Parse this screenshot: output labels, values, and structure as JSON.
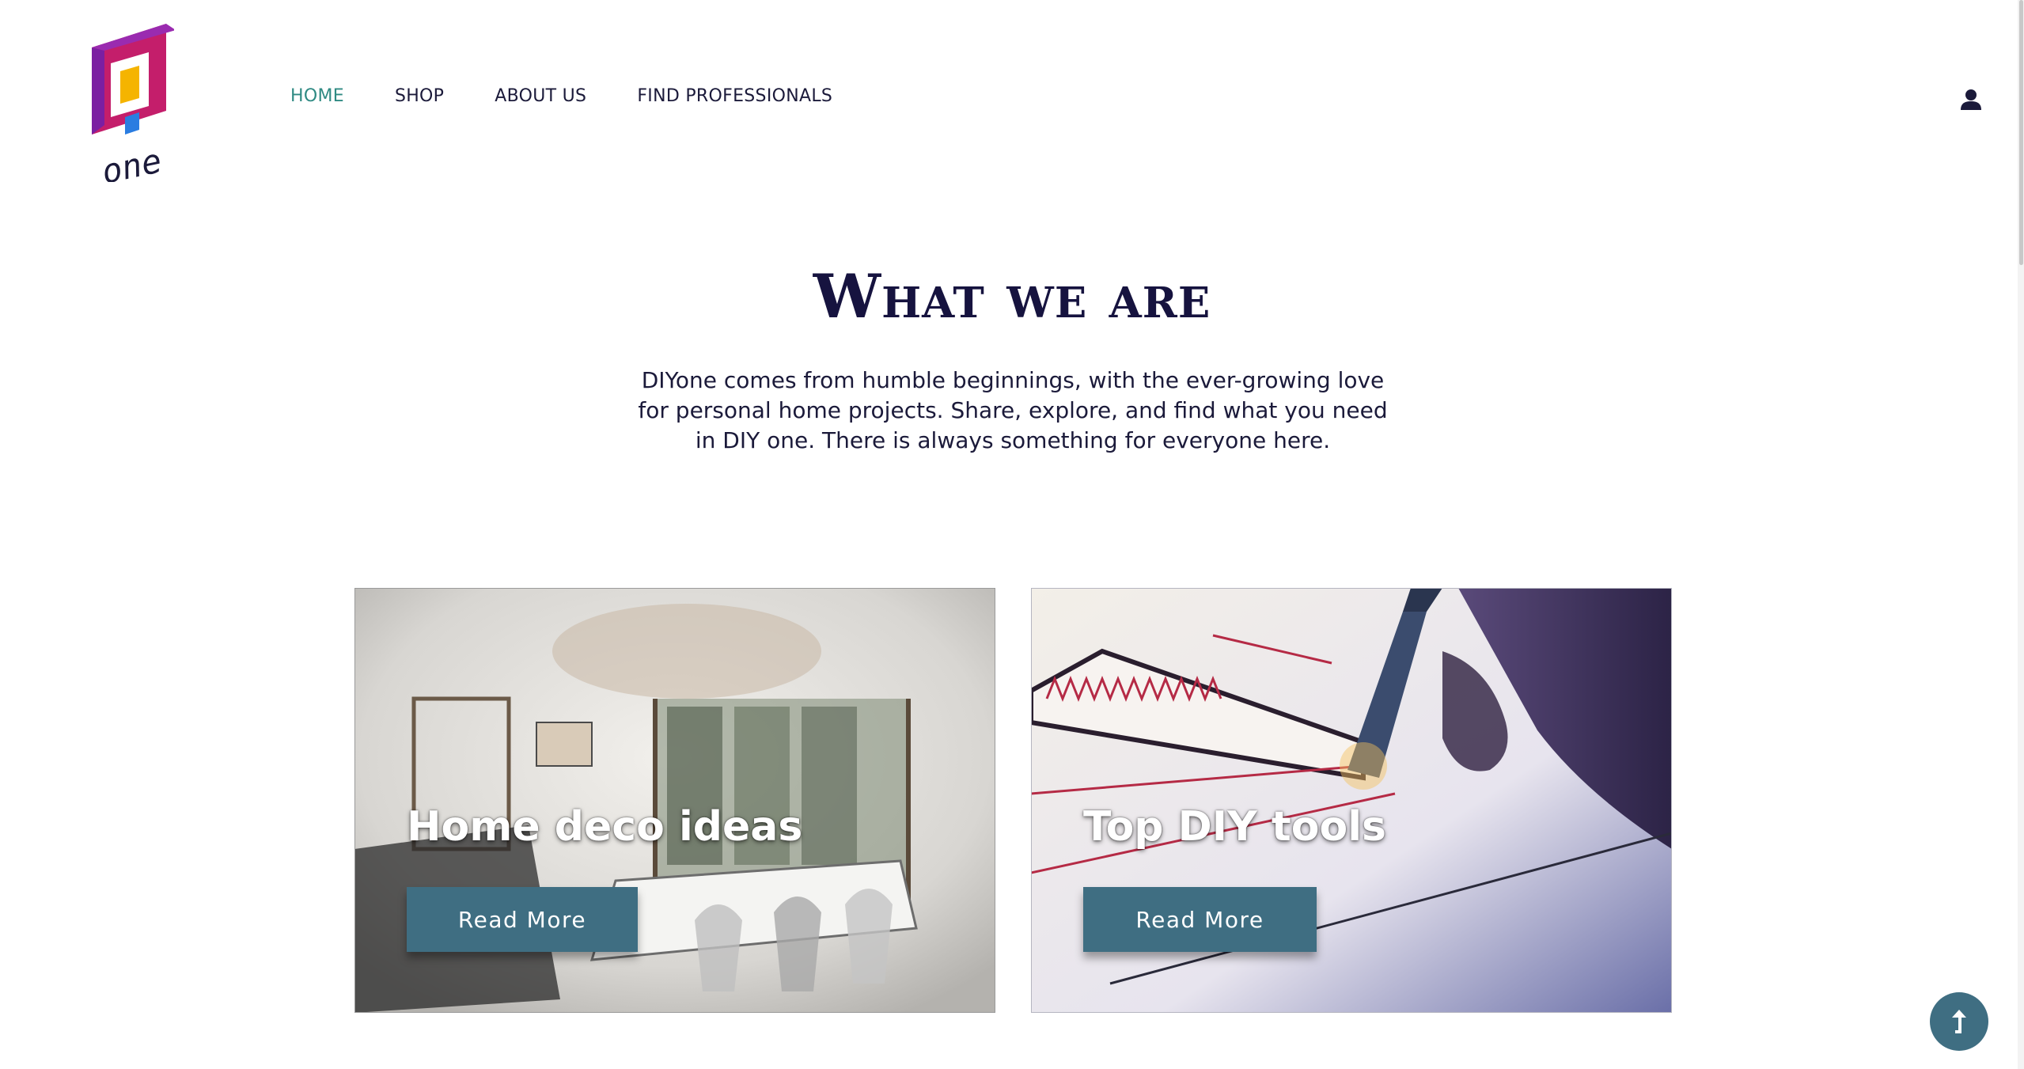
{
  "header": {
    "logo_text": "one",
    "nav": [
      {
        "label": "HOME",
        "active": true
      },
      {
        "label": "SHOP",
        "active": false
      },
      {
        "label": "ABOUT US",
        "active": false
      },
      {
        "label": "FIND PROFESSIONALS",
        "active": false
      }
    ],
    "user_icon": "user-icon"
  },
  "hero": {
    "heading": "What we are",
    "intro": "DIYone comes from humble beginnings, with the ever-growing love for personal home projects. Share, explore, and find what you need in DIY one. There is always something for everyone here."
  },
  "cards": [
    {
      "title": "Home deco ideas",
      "button": "Read More",
      "image": "sketched-dining-room-image"
    },
    {
      "title": "Top DIY tools",
      "button": "Read More",
      "image": "pen-drawing-plan-image"
    }
  ],
  "back_to_top_icon": "arrow-up-icon",
  "colors": {
    "accent": "#2f8a83",
    "heading": "#16133f",
    "text": "#1b1a3a",
    "button": "#3f6e82"
  }
}
